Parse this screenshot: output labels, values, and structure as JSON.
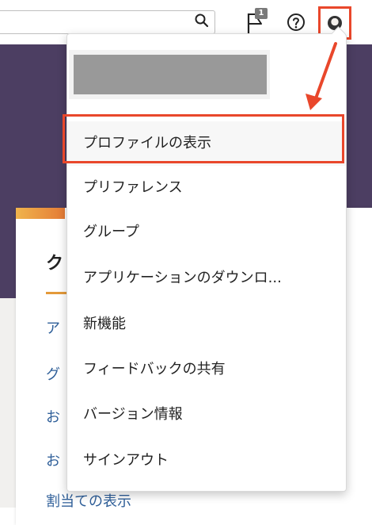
{
  "topbar": {
    "search_icon": "search-icon",
    "notification_count": "1",
    "flag_icon": "flag-icon",
    "help_icon": "help-icon",
    "avatar_icon": "avatar"
  },
  "card": {
    "title": "ク",
    "links": [
      "ア",
      "グ",
      "お",
      "お",
      "割当ての表示"
    ]
  },
  "menu": {
    "items": [
      "プロファイルの表示",
      "プリファレンス",
      "グループ",
      "アプリケーションのダウンロ...",
      "新機能",
      "フィードバックの共有",
      "バージョン情報",
      "サインアウト"
    ]
  },
  "colors": {
    "accent": "#e9472b",
    "banner": "#4c3e62",
    "link": "#2f5f99"
  }
}
